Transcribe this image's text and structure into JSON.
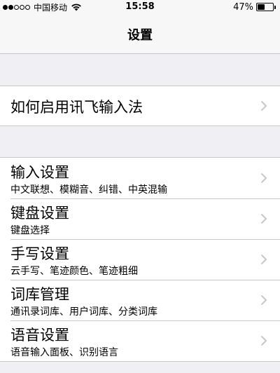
{
  "status_bar": {
    "carrier": "中国移动",
    "time": "15:58",
    "battery_percent": "47%",
    "battery_level": 0.47,
    "signal_bars_filled": 2,
    "signal_bars_total": 5
  },
  "nav": {
    "title": "设置"
  },
  "group1": {
    "items": [
      {
        "title": "如何启用讯飞输入法"
      }
    ]
  },
  "group2": {
    "items": [
      {
        "title": "输入设置",
        "subtitle": "中文联想、模糊音、纠错、中英混输"
      },
      {
        "title": "键盘设置",
        "subtitle": "键盘选择"
      },
      {
        "title": "手写设置",
        "subtitle": "云手写、笔迹颜色、笔迹粗细"
      },
      {
        "title": "词库管理",
        "subtitle": "通讯录词库、用户词库、分类词库"
      },
      {
        "title": "语音设置",
        "subtitle": "语音输入面板、识别语言"
      }
    ]
  },
  "colors": {
    "background": "#efeff4",
    "separator": "#c8c7cc",
    "chevron": "#c7c7cc"
  },
  "icons": {
    "chevron": "chevron-right-icon",
    "wifi": "wifi-icon",
    "battery": "battery-icon"
  }
}
